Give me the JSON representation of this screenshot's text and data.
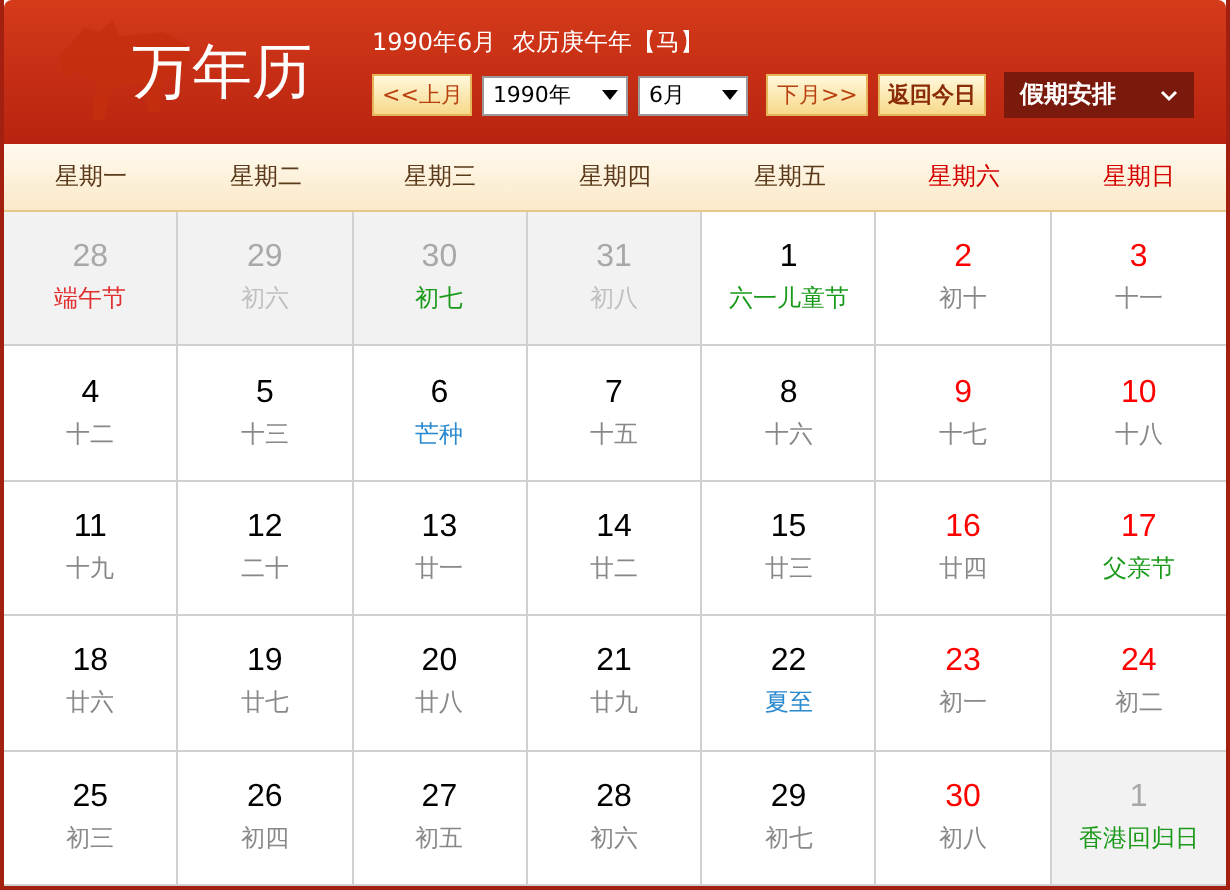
{
  "header": {
    "title": "万年历",
    "date_info": "1990年6月  农历庚午年【马】",
    "prev_button": "<<上月",
    "year_select": "1990年",
    "month_select": "6月",
    "next_button": "下月>>",
    "today_button": "返回今日",
    "holiday_menu": "假期安排"
  },
  "weekdays": [
    {
      "label": "星期一",
      "weekend": false
    },
    {
      "label": "星期二",
      "weekend": false
    },
    {
      "label": "星期三",
      "weekend": false
    },
    {
      "label": "星期四",
      "weekend": false
    },
    {
      "label": "星期五",
      "weekend": false
    },
    {
      "label": "星期六",
      "weekend": true
    },
    {
      "label": "星期日",
      "weekend": true
    }
  ],
  "weeks": [
    [
      {
        "day": "28",
        "sub": "端午节",
        "kind": "traditional",
        "other_month": true
      },
      {
        "day": "29",
        "sub": "初六",
        "kind": "lunar",
        "other_month": true
      },
      {
        "day": "30",
        "sub": "初七",
        "kind": "festival",
        "other_month": true
      },
      {
        "day": "31",
        "sub": "初八",
        "kind": "lunar",
        "other_month": true
      },
      {
        "day": "1",
        "sub": "六一儿童节",
        "kind": "festival",
        "other_month": false
      },
      {
        "day": "2",
        "sub": "初十",
        "kind": "lunar",
        "other_month": false
      },
      {
        "day": "3",
        "sub": "十一",
        "kind": "lunar",
        "other_month": false
      }
    ],
    [
      {
        "day": "4",
        "sub": "十二",
        "kind": "lunar",
        "other_month": false
      },
      {
        "day": "5",
        "sub": "十三",
        "kind": "lunar",
        "other_month": false
      },
      {
        "day": "6",
        "sub": "芒种",
        "kind": "term",
        "other_month": false
      },
      {
        "day": "7",
        "sub": "十五",
        "kind": "lunar",
        "other_month": false
      },
      {
        "day": "8",
        "sub": "十六",
        "kind": "lunar",
        "other_month": false
      },
      {
        "day": "9",
        "sub": "十七",
        "kind": "lunar",
        "other_month": false
      },
      {
        "day": "10",
        "sub": "十八",
        "kind": "lunar",
        "other_month": false
      }
    ],
    [
      {
        "day": "11",
        "sub": "十九",
        "kind": "lunar",
        "other_month": false
      },
      {
        "day": "12",
        "sub": "二十",
        "kind": "lunar",
        "other_month": false
      },
      {
        "day": "13",
        "sub": "廿一",
        "kind": "lunar",
        "other_month": false
      },
      {
        "day": "14",
        "sub": "廿二",
        "kind": "lunar",
        "other_month": false
      },
      {
        "day": "15",
        "sub": "廿三",
        "kind": "lunar",
        "other_month": false
      },
      {
        "day": "16",
        "sub": "廿四",
        "kind": "lunar",
        "other_month": false
      },
      {
        "day": "17",
        "sub": "父亲节",
        "kind": "festival",
        "other_month": false
      }
    ],
    [
      {
        "day": "18",
        "sub": "廿六",
        "kind": "lunar",
        "other_month": false
      },
      {
        "day": "19",
        "sub": "廿七",
        "kind": "lunar",
        "other_month": false
      },
      {
        "day": "20",
        "sub": "廿八",
        "kind": "lunar",
        "other_month": false
      },
      {
        "day": "21",
        "sub": "廿九",
        "kind": "lunar",
        "other_month": false
      },
      {
        "day": "22",
        "sub": "夏至",
        "kind": "term",
        "other_month": false
      },
      {
        "day": "23",
        "sub": "初一",
        "kind": "lunar",
        "other_month": false
      },
      {
        "day": "24",
        "sub": "初二",
        "kind": "lunar",
        "other_month": false
      }
    ],
    [
      {
        "day": "25",
        "sub": "初三",
        "kind": "lunar",
        "other_month": false
      },
      {
        "day": "26",
        "sub": "初四",
        "kind": "lunar",
        "other_month": false
      },
      {
        "day": "27",
        "sub": "初五",
        "kind": "lunar",
        "other_month": false
      },
      {
        "day": "28",
        "sub": "初六",
        "kind": "lunar",
        "other_month": false
      },
      {
        "day": "29",
        "sub": "初七",
        "kind": "lunar",
        "other_month": false
      },
      {
        "day": "30",
        "sub": "初八",
        "kind": "lunar",
        "other_month": false
      },
      {
        "day": "1",
        "sub": "香港回归日",
        "kind": "festival",
        "other_month": true
      }
    ]
  ]
}
